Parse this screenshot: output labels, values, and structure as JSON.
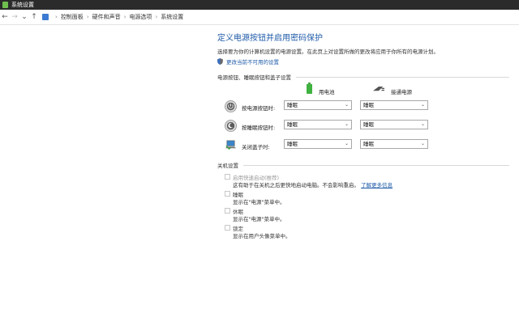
{
  "window": {
    "title": "系统设置"
  },
  "address_bar": {
    "back_icon": "←",
    "forward_icon": "→",
    "recent_icon": "⌄",
    "up_icon": "↑",
    "breadcrumb": [
      "控制面板",
      "硬件和声音",
      "电源选项",
      "系统设置"
    ],
    "separator": "›"
  },
  "page": {
    "title": "定义电源按钮并启用密码保护",
    "description": "选择要为你的计算机设置的电源设置。在此页上对设置所做的更改将应用于你所有的电源计划。",
    "change_link": "更改当前不可用的设置"
  },
  "power_buttons": {
    "section_title": "电源按钮、睡眠按钮和盖子设置",
    "col_battery": "用电池",
    "col_plugged": "接通电源",
    "dropdown_arrow": "⌄",
    "rows": [
      {
        "label": "按电源按钮时:",
        "battery": "睡眠",
        "plugged": "睡眠"
      },
      {
        "label": "按睡眠按钮时:",
        "battery": "睡眠",
        "plugged": "睡眠"
      },
      {
        "label": "关闭盖子时:",
        "battery": "睡眠",
        "plugged": "睡眠"
      }
    ]
  },
  "shutdown": {
    "section_title": "关机设置",
    "items": [
      {
        "title": "启用快速启动(推荐)",
        "desc": "这有助于在关机之后更快地启动电脑。不会影响重启。",
        "link": "了解更多信息"
      },
      {
        "title": "睡眠",
        "desc": "显示在\"电源\"菜单中。"
      },
      {
        "title": "休眠",
        "desc": "显示在\"电源\"菜单中。"
      },
      {
        "title": "锁定",
        "desc": "显示在用户头像菜单中。"
      }
    ]
  },
  "colors": {
    "accent": "#1e5aa8",
    "titlebar": "#2b2b2b"
  }
}
